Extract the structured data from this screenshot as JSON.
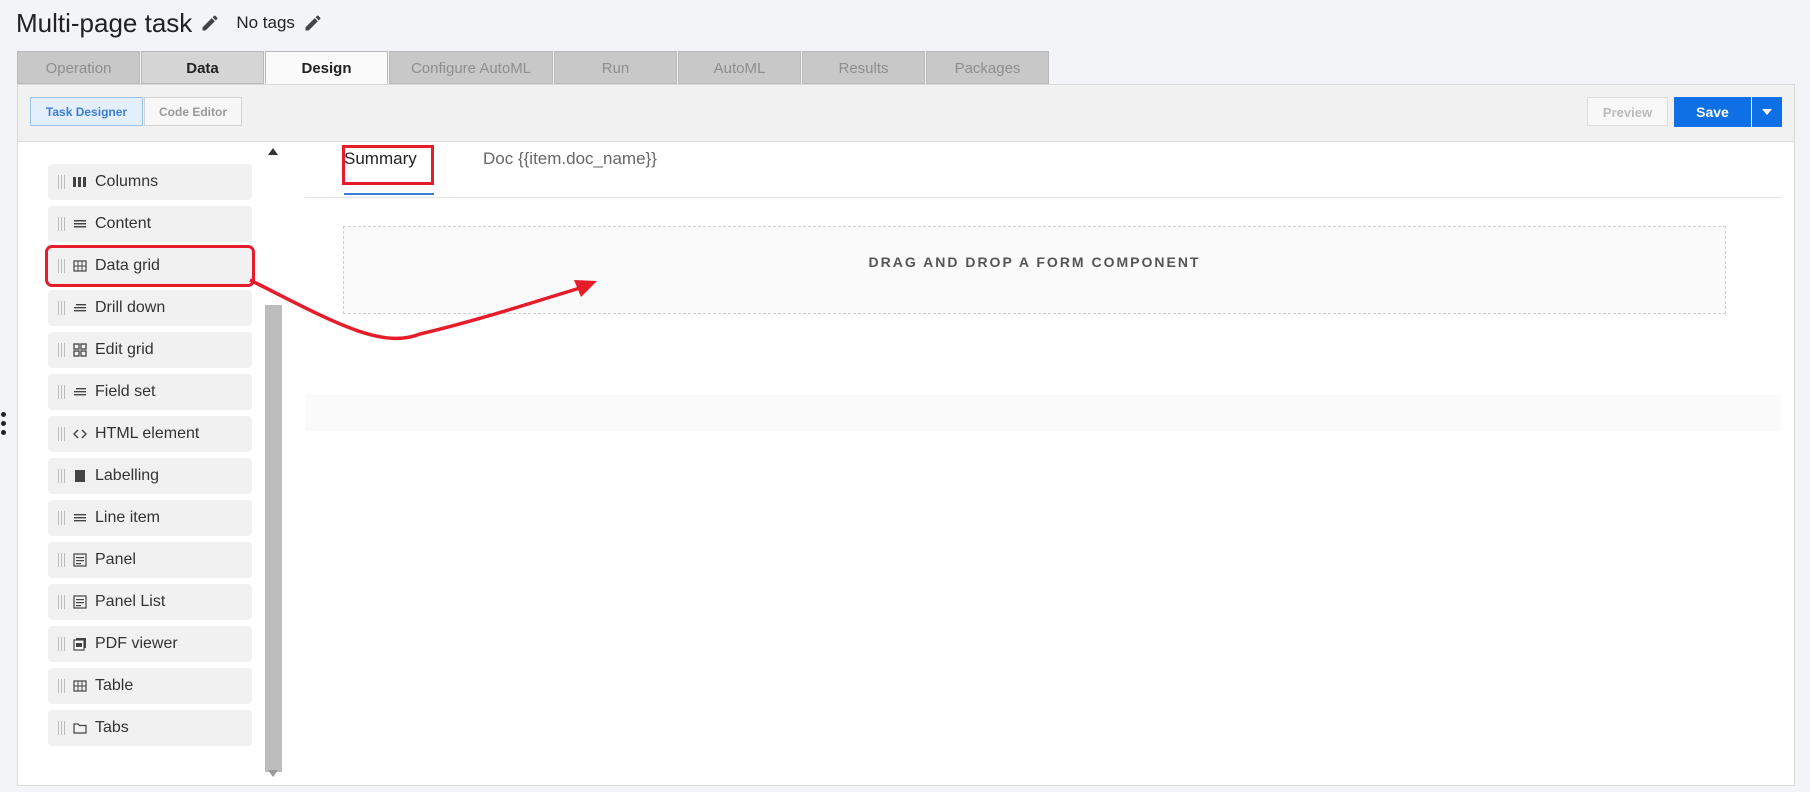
{
  "header": {
    "title": "Multi-page task",
    "tags_label": "No tags"
  },
  "tabs": [
    {
      "label": "Operation",
      "state": "disabled"
    },
    {
      "label": "Data",
      "state": "normal"
    },
    {
      "label": "Design",
      "state": "active"
    },
    {
      "label": "Configure AutoML",
      "state": "disabled"
    },
    {
      "label": "Run",
      "state": "disabled"
    },
    {
      "label": "AutoML",
      "state": "disabled"
    },
    {
      "label": "Results",
      "state": "disabled"
    },
    {
      "label": "Packages",
      "state": "disabled"
    }
  ],
  "toolbar": {
    "task_designer": "Task Designer",
    "code_editor": "Code Editor",
    "preview": "Preview",
    "save": "Save"
  },
  "palette": [
    {
      "label": "Columns",
      "icon": "columns-icon"
    },
    {
      "label": "Content",
      "icon": "content-icon"
    },
    {
      "label": "Data grid",
      "icon": "grid-icon",
      "highlighted": true
    },
    {
      "label": "Drill down",
      "icon": "lines-icon"
    },
    {
      "label": "Edit grid",
      "icon": "edit-grid-icon"
    },
    {
      "label": "Field set",
      "icon": "lines-icon"
    },
    {
      "label": "HTML element",
      "icon": "code-icon"
    },
    {
      "label": "Labelling",
      "icon": "bookmark-icon"
    },
    {
      "label": "Line item",
      "icon": "list-icon"
    },
    {
      "label": "Panel",
      "icon": "panel-icon"
    },
    {
      "label": "Panel List",
      "icon": "panel-icon"
    },
    {
      "label": "PDF viewer",
      "icon": "pdf-icon"
    },
    {
      "label": "Table",
      "icon": "table-icon"
    },
    {
      "label": "Tabs",
      "icon": "folder-icon"
    }
  ],
  "pages": [
    {
      "label": "Summary",
      "active": true
    },
    {
      "label": "Doc {{item.doc_name}}",
      "active": false
    }
  ],
  "dropzone": {
    "text": "DRAG AND DROP A FORM COMPONENT"
  },
  "colors": {
    "accent": "#0f6fe5",
    "annotation": "#e61c2b"
  }
}
